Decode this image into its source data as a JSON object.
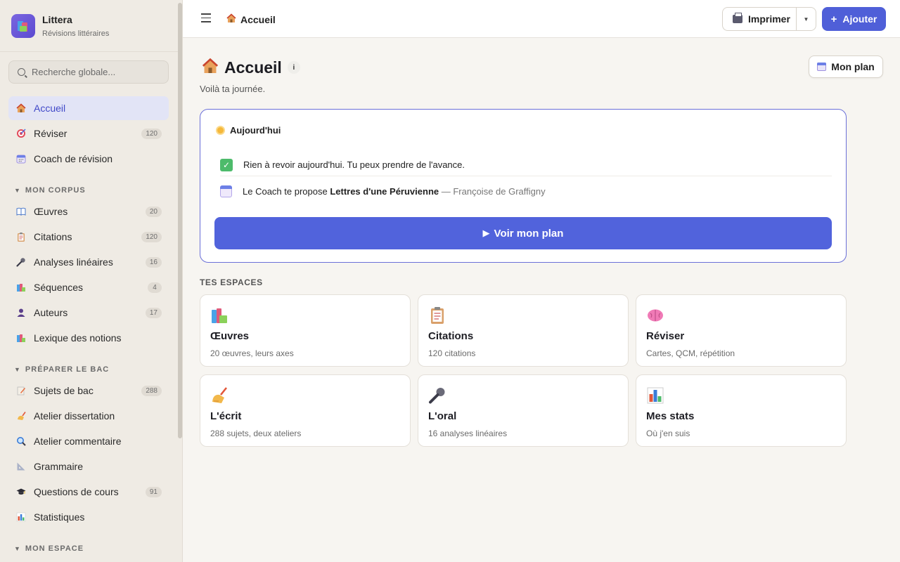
{
  "brand": {
    "name": "Littera",
    "subtitle": "Révisions littéraires"
  },
  "search": {
    "placeholder": "Recherche globale..."
  },
  "nav": {
    "accueil": {
      "label": "Accueil",
      "icon": "house-icon"
    },
    "reviser": {
      "label": "Réviser",
      "badge": "120",
      "icon": "target-icon"
    },
    "coach": {
      "label": "Coach de révision",
      "icon": "calendar-icon"
    },
    "corpus_title": "MON CORPUS",
    "oeuvres": {
      "label": "Œuvres",
      "badge": "20",
      "icon": "book-icon"
    },
    "citations": {
      "label": "Citations",
      "badge": "120",
      "icon": "clipboard-icon"
    },
    "analyses": {
      "label": "Analyses linéaires",
      "badge": "16",
      "icon": "microphone-icon"
    },
    "sequences": {
      "label": "Séquences",
      "badge": "4",
      "icon": "books-icon"
    },
    "auteurs": {
      "label": "Auteurs",
      "badge": "17",
      "icon": "person-icon"
    },
    "lexique": {
      "label": "Lexique des notions",
      "icon": "books-icon"
    },
    "bac_title": "PRÉPARER LE BAC",
    "sujets": {
      "label": "Sujets de bac",
      "badge": "288",
      "icon": "memo-icon"
    },
    "dissertation": {
      "label": "Atelier dissertation",
      "icon": "writing-hand-icon"
    },
    "commentaire": {
      "label": "Atelier commentaire",
      "icon": "magnifier-icon"
    },
    "grammaire": {
      "label": "Grammaire",
      "icon": "triangle-ruler-icon"
    },
    "questions": {
      "label": "Questions de cours",
      "badge": "91",
      "icon": "graduation-cap-icon"
    },
    "statistiques": {
      "label": "Statistiques",
      "icon": "bar-chart-icon"
    },
    "espace_title": "MON ESPACE"
  },
  "topbar": {
    "breadcrumb": "Accueil",
    "print_label": "Imprimer",
    "add_label": "Ajouter"
  },
  "main": {
    "title": "Accueil",
    "info": "i",
    "subtitle": "Voilà ta journée.",
    "plan_button": "Mon plan",
    "today": {
      "heading": "Aujourd'hui",
      "row1": "Rien à revoir aujourd'hui. Tu peux prendre de l'avance.",
      "row2_prefix": "Le Coach te propose ",
      "row2_work": "Lettres d'une Péruvienne",
      "row2_author": " — Françoise de Graffigny",
      "cta": "Voir mon plan"
    },
    "spaces_title": "TES ESPACES",
    "spaces": [
      {
        "title": "Œuvres",
        "sub": "20 œuvres, leurs axes",
        "icon": "books-icon"
      },
      {
        "title": "Citations",
        "sub": "120 citations",
        "icon": "clipboard-icon"
      },
      {
        "title": "Réviser",
        "sub": "Cartes, QCM, répétition",
        "icon": "brain-icon"
      },
      {
        "title": "L'écrit",
        "sub": "288 sujets, deux ateliers",
        "icon": "writing-hand-icon"
      },
      {
        "title": "L'oral",
        "sub": "16 analyses linéaires",
        "icon": "microphone-icon"
      },
      {
        "title": "Mes stats",
        "sub": "Où j'en suis",
        "icon": "bar-chart-icon"
      }
    ]
  },
  "colors": {
    "accent": "#4f5fd8",
    "sidebar_bg": "#efebe4",
    "page_bg": "#f7f5f1",
    "active_nav_bg": "#e2e4f6"
  }
}
